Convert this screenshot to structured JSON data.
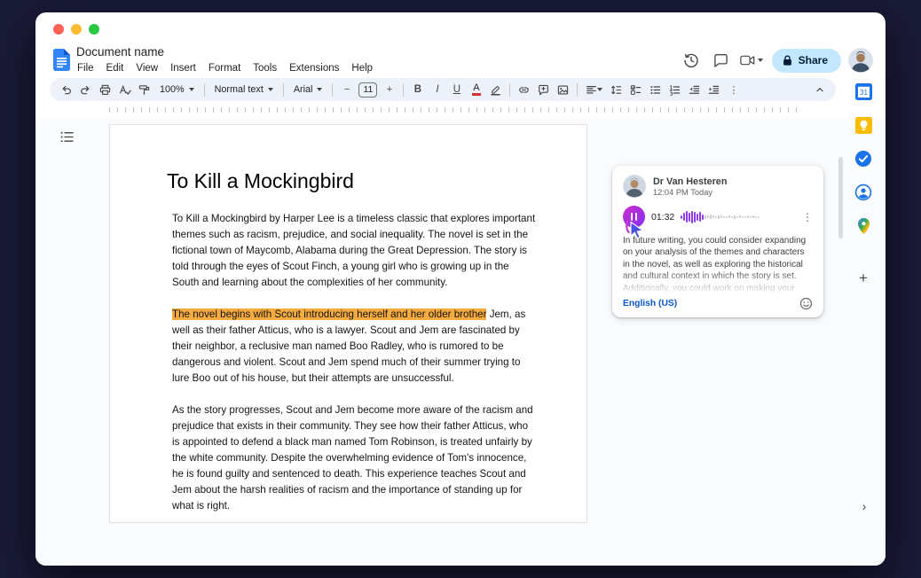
{
  "colors": {
    "desktop_bg": "#191A36",
    "accent_blue": "#1A73E8",
    "toolbar_bg": "#EDF2FA",
    "share_button_bg": "#C2E7FF",
    "share_button_text": "#001D35",
    "highlight_orange": "#F6AB40",
    "audio_button_purple": "#A93AE0",
    "link_blue": "#0B57D0"
  },
  "window": {
    "controls": [
      "close",
      "minimize",
      "zoom"
    ]
  },
  "header": {
    "doc_title": "Document name",
    "menu_items": [
      "File",
      "Edit",
      "View",
      "Insert",
      "Format",
      "Tools",
      "Extensions",
      "Help"
    ],
    "share_label": "Share"
  },
  "toolbar": {
    "zoom_value": "100%",
    "style_value": "Normal text",
    "font_value": "Arial",
    "decrease_font_label": "−",
    "font_size_value": "11",
    "increase_font_label": "+",
    "bold_label": "B",
    "italic_label": "I",
    "underline_label": "U",
    "text_color_label": "A",
    "more_label": "⋮"
  },
  "document": {
    "title": "To Kill a Mockingbird",
    "paragraph_1": "To Kill a Mockingbird by Harper Lee is a timeless classic that explores important themes such as racism, prejudice, and social inequality. The novel is set in the fictional town of Maycomb, Alabama during the Great Depression. The story is told through the eyes of Scout Finch, a young girl who is growing up in the South and learning about the complexities of her community.",
    "paragraph_2_highlight": "The novel begins with Scout introducing herself and her older brother",
    "paragraph_2_rest": " Jem, as well as their father Atticus, who is a lawyer. Scout and Jem are fascinated by their neighbor, a reclusive man named Boo Radley, who is rumored to be dangerous and violent. Scout and Jem spend much of their summer trying to lure Boo out of his house, but their attempts are unsuccessful.",
    "paragraph_3": "As the story progresses, Scout and Jem become more aware of the racism and prejudice that exists in their community. They see how their father Atticus, who is appointed to defend a black man named Tom Robinson, is treated unfairly by the white community. Despite the overwhelming evidence of Tom's innocence, he is found guilty and sentenced to death. This experience teaches Scout and Jem about the harsh realities of racism and the importance of standing up for what is right."
  },
  "comment_card": {
    "author": "Dr Van Hesteren",
    "timestamp": "12:04 PM Today",
    "audio_time": "01:32",
    "menu_label": "⋮",
    "body": "In future writing, you could consider expanding on your analysis of the themes and characters in the novel, as well as exploring the historical and cultural context in which the story is set. Additionally, you could work on making your",
    "language_label": "English (US)",
    "waveform": {
      "heights": [
        4,
        9,
        13,
        10,
        14,
        12,
        8,
        11,
        6,
        4,
        3,
        5,
        3,
        2,
        4,
        3,
        2,
        2,
        3,
        2,
        4,
        2,
        3,
        2,
        2,
        3,
        2,
        3,
        2,
        2
      ],
      "played_count": 9
    }
  },
  "side_panel": {
    "calendar_day": "31",
    "icons": [
      "calendar",
      "keep",
      "tasks",
      "contacts",
      "maps"
    ],
    "add_label": "+",
    "collapse_label": "›"
  }
}
